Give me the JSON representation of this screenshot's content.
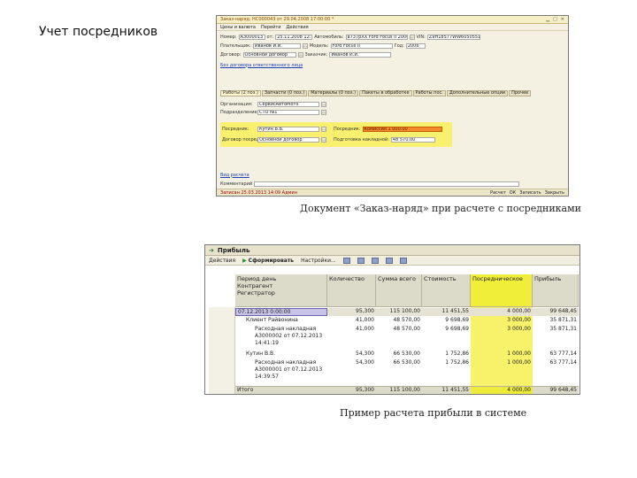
{
  "slide_title": "Учет посредников",
  "caption1": "Документ «Заказ-наряд» при расчете с посредниками",
  "caption2": "Пример расчета прибыли в системе",
  "order_window": {
    "title": "Заказ-наряд: НС000043 от 29.04.2008 17:00:00 *",
    "toolbar": [
      "Цены и валюта",
      "Перейти",
      "Действия"
    ],
    "tabs": [
      "Работы (2 поз.)",
      "Запчасти (0 поз.)",
      "Материалы (0 поз.)",
      "Пакеты в обработке",
      "Работы пос.",
      "Дополнительные опции",
      "Прочее"
    ],
    "fields": {
      "number_label": "Номер:",
      "number": "А3000013",
      "date_label": "от:",
      "date": "25.11.2008 12:30:00",
      "auto_label": "Автомобиль:",
      "auto": "а737рХХ Ford Focus II 2006",
      "vin_label": "VIN:",
      "vin": "Z9H18577WW6050551",
      "payer_label": "Плательщик:",
      "payer": "Иванов И.И.",
      "model_label": "Модель:",
      "model": "Ford Focus II",
      "year_label": "Год:",
      "year": "2006",
      "contract_label": "Договор:",
      "contract": "Основной договор",
      "customer_label": "Заказчик:",
      "customer": "Иванов И.И.",
      "link_text": "Без договора ответственного лица",
      "org_label": "Организация:",
      "org": "СервисАвтоМото",
      "division_label": "Подразделение:",
      "division": "СТО №1",
      "intermediary_label": "Посредник:",
      "intermediary": "Кутин В.В.",
      "contract2_label": "Договор посредника:",
      "contract2": "Основной договор",
      "commission_label": "Посредник:",
      "commission": "Комиссия 1 000.00",
      "accrual_label": "Подготовка накладной:",
      "accrual": "48 570.00"
    },
    "footer_links": [
      "Вид расчета",
      "Комментарий",
      "Ответственный"
    ],
    "status_text": "Записан 25.03.2013 14:09 Админ",
    "status_buttons": [
      "Расчет",
      "ОК",
      "Записать",
      "Закрыть"
    ]
  },
  "profit_window": {
    "title": "Прибыль",
    "toolbar": [
      "Действия",
      "Сформировать",
      "Настройки..."
    ],
    "headers": {
      "period": "Период день",
      "counterparty": "Контрагент",
      "registrar": "Регистратор",
      "quantity": "Количество",
      "sum": "Сумма всего",
      "cost": "Стоимость",
      "intermediary": "Посредническое",
      "profit": "Прибыль"
    },
    "rows": [
      {
        "name": "07.12.2013 0:00:00",
        "qty": "95,300",
        "sum": "115 100,00",
        "cost": "11 451,55",
        "inter": "4 000,00",
        "profit": "99 648,45"
      },
      {
        "name": "Клиент Райвонина",
        "qty": "41,000",
        "sum": "48 570,00",
        "cost": "9 698,69",
        "inter": "3 000,00",
        "profit": "35 871,31"
      },
      {
        "name": "Расходная накладная А3000002 от 07.12.2013 14:41:19",
        "qty": "41,000",
        "sum": "48 570,00",
        "cost": "9 698,69",
        "inter": "3 000,00",
        "profit": "35 871,31"
      },
      {
        "name": "Кутин В.В.",
        "qty": "54,300",
        "sum": "66 530,00",
        "cost": "1 752,86",
        "inter": "1 000,00",
        "profit": "63 777,14"
      },
      {
        "name": "Расходная накладная А3000001 от 07.12.2013 14:39:57",
        "qty": "54,300",
        "sum": "66 530,00",
        "cost": "1 752,86",
        "inter": "1 000,00",
        "profit": "63 777,14"
      }
    ],
    "total": {
      "name": "Итого",
      "qty": "95,300",
      "sum": "115 100,00",
      "cost": "11 451,55",
      "inter": "4 000,00",
      "profit": "99 648,45"
    }
  }
}
